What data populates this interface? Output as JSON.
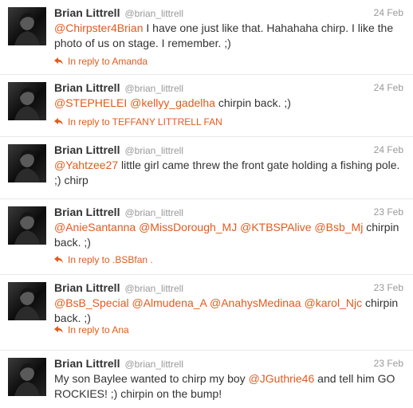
{
  "colors": {
    "accent": "#e05b1e",
    "text": "#333333",
    "muted": "#999999"
  },
  "tweets": [
    {
      "name": "Brian Littrell",
      "handle": "@brian_littrell",
      "date": "24 Feb",
      "segments": [
        {
          "text": "@Chirpster4Brian",
          "mention": true
        },
        {
          "text": " I have one just like that. Hahahaha chirp. I like the photo of us on stage. I remember. ;)",
          "mention": false
        }
      ],
      "reply": "In reply to Amanda"
    },
    {
      "name": "Brian Littrell",
      "handle": "@brian_littrell",
      "date": "24 Feb",
      "segments": [
        {
          "text": "@STEPHELEI",
          "mention": true
        },
        {
          "text": " ",
          "mention": false
        },
        {
          "text": "@kellyy_gadelha",
          "mention": true
        },
        {
          "text": " chirpin back. ;)",
          "mention": false
        }
      ],
      "reply": "In reply to TEFFANY LITTRELL FAN"
    },
    {
      "name": "Brian Littrell",
      "handle": "@brian_littrell",
      "date": "24 Feb",
      "segments": [
        {
          "text": "@Yahtzee27",
          "mention": true
        },
        {
          "text": " little girl came threw the front gate holding a fishing pole. ;) chirp",
          "mention": false
        }
      ],
      "reply": ""
    },
    {
      "name": "Brian Littrell",
      "handle": "@brian_littrell",
      "date": "23 Feb",
      "segments": [
        {
          "text": "@AnieSantanna",
          "mention": true
        },
        {
          "text": " ",
          "mention": false
        },
        {
          "text": "@MissDorough_MJ",
          "mention": true
        },
        {
          "text": " ",
          "mention": false
        },
        {
          "text": "@KTBSPAlive",
          "mention": true
        },
        {
          "text": " ",
          "mention": false
        },
        {
          "text": "@Bsb_Mj",
          "mention": true
        },
        {
          "text": " chirpin back. ;)",
          "mention": false
        }
      ],
      "reply": "In reply to .BSBfan ."
    },
    {
      "name": "Brian Littrell",
      "handle": "@brian_littrell",
      "date": "23 Feb",
      "segments": [
        {
          "text": "@BsB_Special",
          "mention": true
        },
        {
          "text": " ",
          "mention": false
        },
        {
          "text": "@Almudena_A",
          "mention": true
        },
        {
          "text": " ",
          "mention": false
        },
        {
          "text": "@AnahysMedinaa",
          "mention": true
        },
        {
          "text": " ",
          "mention": false
        },
        {
          "text": "@karol_Njc",
          "mention": true
        },
        {
          "text": " chirpin back. ;)",
          "mention": false
        }
      ],
      "reply": "In reply to Ana"
    },
    {
      "name": "Brian Littrell",
      "handle": "@brian_littrell",
      "date": "23 Feb",
      "segments": [
        {
          "text": "My son Baylee wanted to chirp my boy ",
          "mention": false
        },
        {
          "text": "@JGuthrie46",
          "mention": true
        },
        {
          "text": " and tell him GO ROCKIES! ;) chirpin on the bump!",
          "mention": false
        }
      ],
      "reply": ""
    }
  ]
}
